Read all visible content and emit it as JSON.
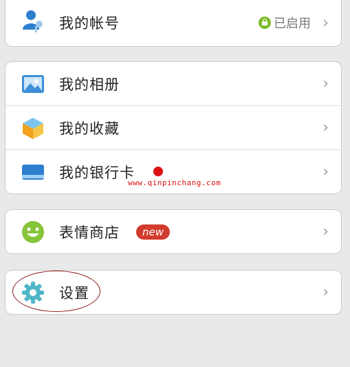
{
  "account": {
    "label": "我的帐号",
    "status": "已启用",
    "icon": "account-icon"
  },
  "group2": [
    {
      "label": "我的相册",
      "icon": "album-icon"
    },
    {
      "label": "我的收藏",
      "icon": "favorites-icon"
    },
    {
      "label": "我的银行卡",
      "icon": "bank-card-icon"
    }
  ],
  "watermark": "www.qinpinchang.com",
  "emoji": {
    "label": "表情商店",
    "badge": "new",
    "icon": "smiley-icon"
  },
  "settings": {
    "label": "设置",
    "icon": "gear-icon"
  },
  "chevron": "›",
  "colors": {
    "badge": "#d23b2e",
    "lock": "#7dbb2b",
    "dot": "#dd1111"
  }
}
